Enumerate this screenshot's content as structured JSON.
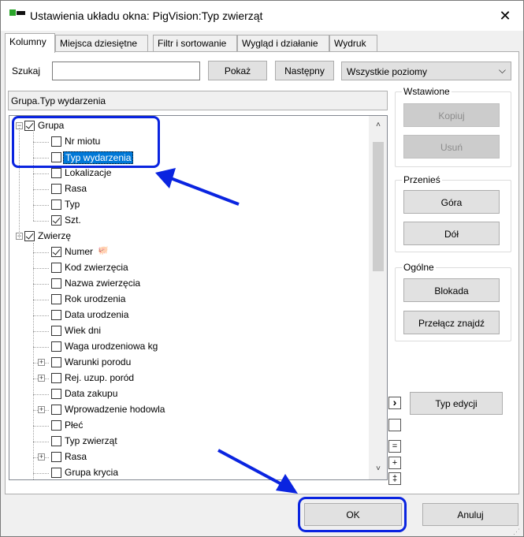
{
  "window": {
    "title": "Ustawienia układu okna: PigVision:Typ zwierząt",
    "close_glyph": "✕"
  },
  "tabs": [
    "Kolumny",
    "Miejsca dziesiętne",
    "Filtr i sortowanie",
    "Wygląd i działanie",
    "Wydruk"
  ],
  "search": {
    "label": "Szukaj",
    "value": "",
    "show_button": "Pokaż",
    "next_button": "Następny",
    "level_select": "Wszystkie poziomy"
  },
  "path": "Grupa.Typ wydarzenia",
  "tree": [
    {
      "label": "Grupa",
      "level": 0,
      "checked": true,
      "expander": "−"
    },
    {
      "label": "Nr miotu",
      "level": 1,
      "checked": false
    },
    {
      "label": "Typ wydarzenia",
      "level": 1,
      "checked": false,
      "selected": true
    },
    {
      "label": "Lokalizacje",
      "level": 1,
      "checked": false
    },
    {
      "label": "Rasa",
      "level": 1,
      "checked": false
    },
    {
      "label": "Typ",
      "level": 1,
      "checked": false
    },
    {
      "label": "Szt.",
      "level": 1,
      "checked": true
    },
    {
      "label": "Zwierzę",
      "level": 0,
      "checked": true,
      "expander": "−"
    },
    {
      "label": "Numer",
      "level": 1,
      "checked": true,
      "icon": "🐖"
    },
    {
      "label": "Kod zwierzęcia",
      "level": 1,
      "checked": false
    },
    {
      "label": "Nazwa zwierzęcia",
      "level": 1,
      "checked": false
    },
    {
      "label": "Rok urodzenia",
      "level": 1,
      "checked": false
    },
    {
      "label": "Data urodzenia",
      "level": 1,
      "checked": false
    },
    {
      "label": "Wiek dni",
      "level": 1,
      "checked": false
    },
    {
      "label": "Waga urodzeniowa kg",
      "level": 1,
      "checked": false
    },
    {
      "label": "Warunki porodu",
      "level": 1,
      "checked": false,
      "expander": "+"
    },
    {
      "label": "Rej. uzup. poród",
      "level": 1,
      "checked": false,
      "expander": "+"
    },
    {
      "label": "Data zakupu",
      "level": 1,
      "checked": false
    },
    {
      "label": "Wprowadzenie hodowla",
      "level": 1,
      "checked": false,
      "expander": "+"
    },
    {
      "label": "Płeć",
      "level": 1,
      "checked": false
    },
    {
      "label": "Typ zwierząt",
      "level": 1,
      "checked": false
    },
    {
      "label": "Rasa",
      "level": 1,
      "checked": false,
      "expander": "+"
    },
    {
      "label": "Grupa krycia",
      "level": 1,
      "checked": false
    }
  ],
  "groups": {
    "inserted": {
      "title": "Wstawione",
      "copy": "Kopiuj",
      "remove": "Usuń"
    },
    "move": {
      "title": "Przenieś",
      "up": "Góra",
      "down": "Dół"
    },
    "general": {
      "title": "Ogólne",
      "lock": "Blokada",
      "toggle_find": "Przełącz znajdź"
    }
  },
  "edit_type_button": "Typ edycji",
  "side_buttons": {
    "arrow": "›",
    "eq": "=",
    "plus": "+",
    "dbl": "‡"
  },
  "footer": {
    "ok": "OK",
    "cancel": "Anuluj"
  },
  "scroll_up": "˄",
  "scroll_down": "˅",
  "accent_color": "#0a24e0",
  "selection_color": "#0078d7"
}
